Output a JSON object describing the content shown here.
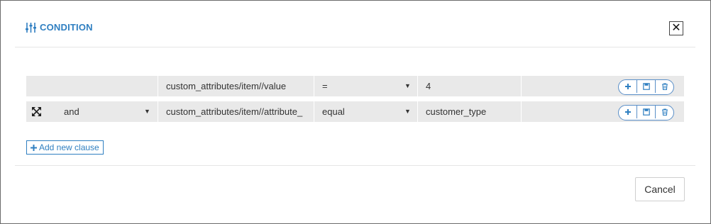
{
  "dialog": {
    "title": "CONDITION",
    "close_label": "✕"
  },
  "rows": [
    {
      "operator_keyword": "",
      "attribute": "custom_attributes/item//value",
      "comparator": "=",
      "value": "4"
    },
    {
      "operator_keyword": "and",
      "attribute": "custom_attributes/item//attribute_",
      "comparator": "equal",
      "value": "customer_type"
    }
  ],
  "add_clause": {
    "icon": "plus-icon",
    "label": "Add new clause"
  },
  "footer": {
    "cancel_label": "Cancel"
  },
  "colors": {
    "accent": "#2f7fc1",
    "row_bg": "#e9e9e9"
  }
}
